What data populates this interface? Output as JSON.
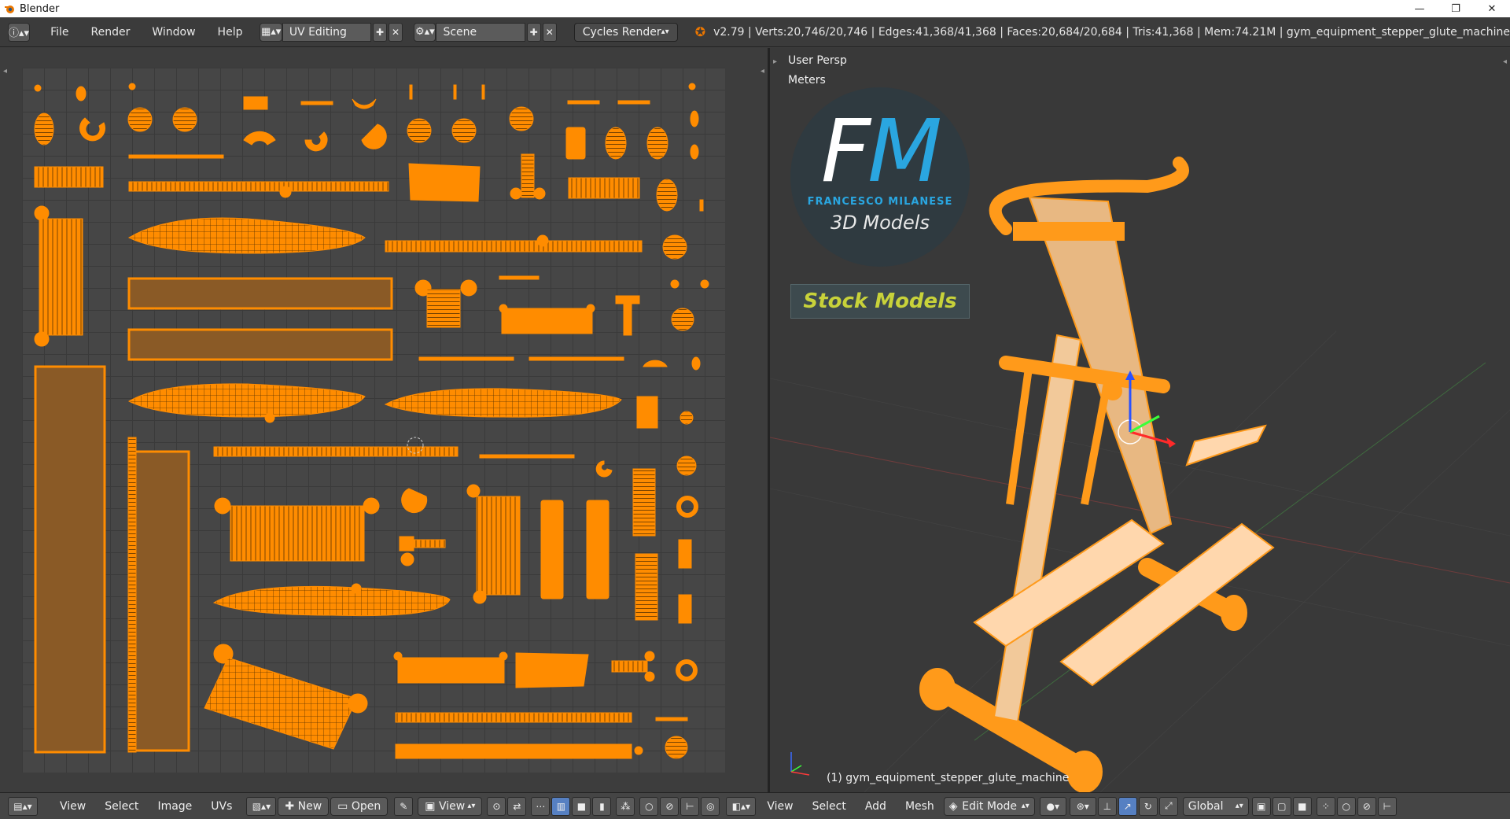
{
  "window": {
    "title": "Blender",
    "min": "—",
    "max": "❐",
    "close": "✕"
  },
  "header": {
    "menus": [
      "File",
      "Render",
      "Window",
      "Help"
    ],
    "layout": "UV Editing",
    "scene": "Scene",
    "engine": "Cycles Render",
    "stats": "v2.79 | Verts:20,746/20,746 | Edges:41,368/41,368 | Faces:20,684/20,684 | Tris:41,368 | Mem:74.21M | gym_equipment_stepper_glute_machine"
  },
  "viewport": {
    "view_name": "User Persp",
    "units": "Meters",
    "object_label": "(1) gym_equipment_stepper_glute_machine"
  },
  "watermark": {
    "letters_f": "F",
    "letters_m": "M",
    "author": "FRANCESCO MILANESE",
    "tagline": "3D Models",
    "stock": "Stock Models"
  },
  "uv_footer": {
    "view": "View",
    "select": "Select",
    "image": "Image",
    "uvs": "UVs",
    "new": "New",
    "open": "Open",
    "view2": "View"
  },
  "vp_footer": {
    "view": "View",
    "select": "Select",
    "add": "Add",
    "mesh": "Mesh",
    "mode": "Edit Mode",
    "orientation": "Global"
  },
  "colors": {
    "uv_orange": "#ff8c00",
    "mesh_orange": "#ff9a1a",
    "mesh_face": "#f2c99a"
  }
}
